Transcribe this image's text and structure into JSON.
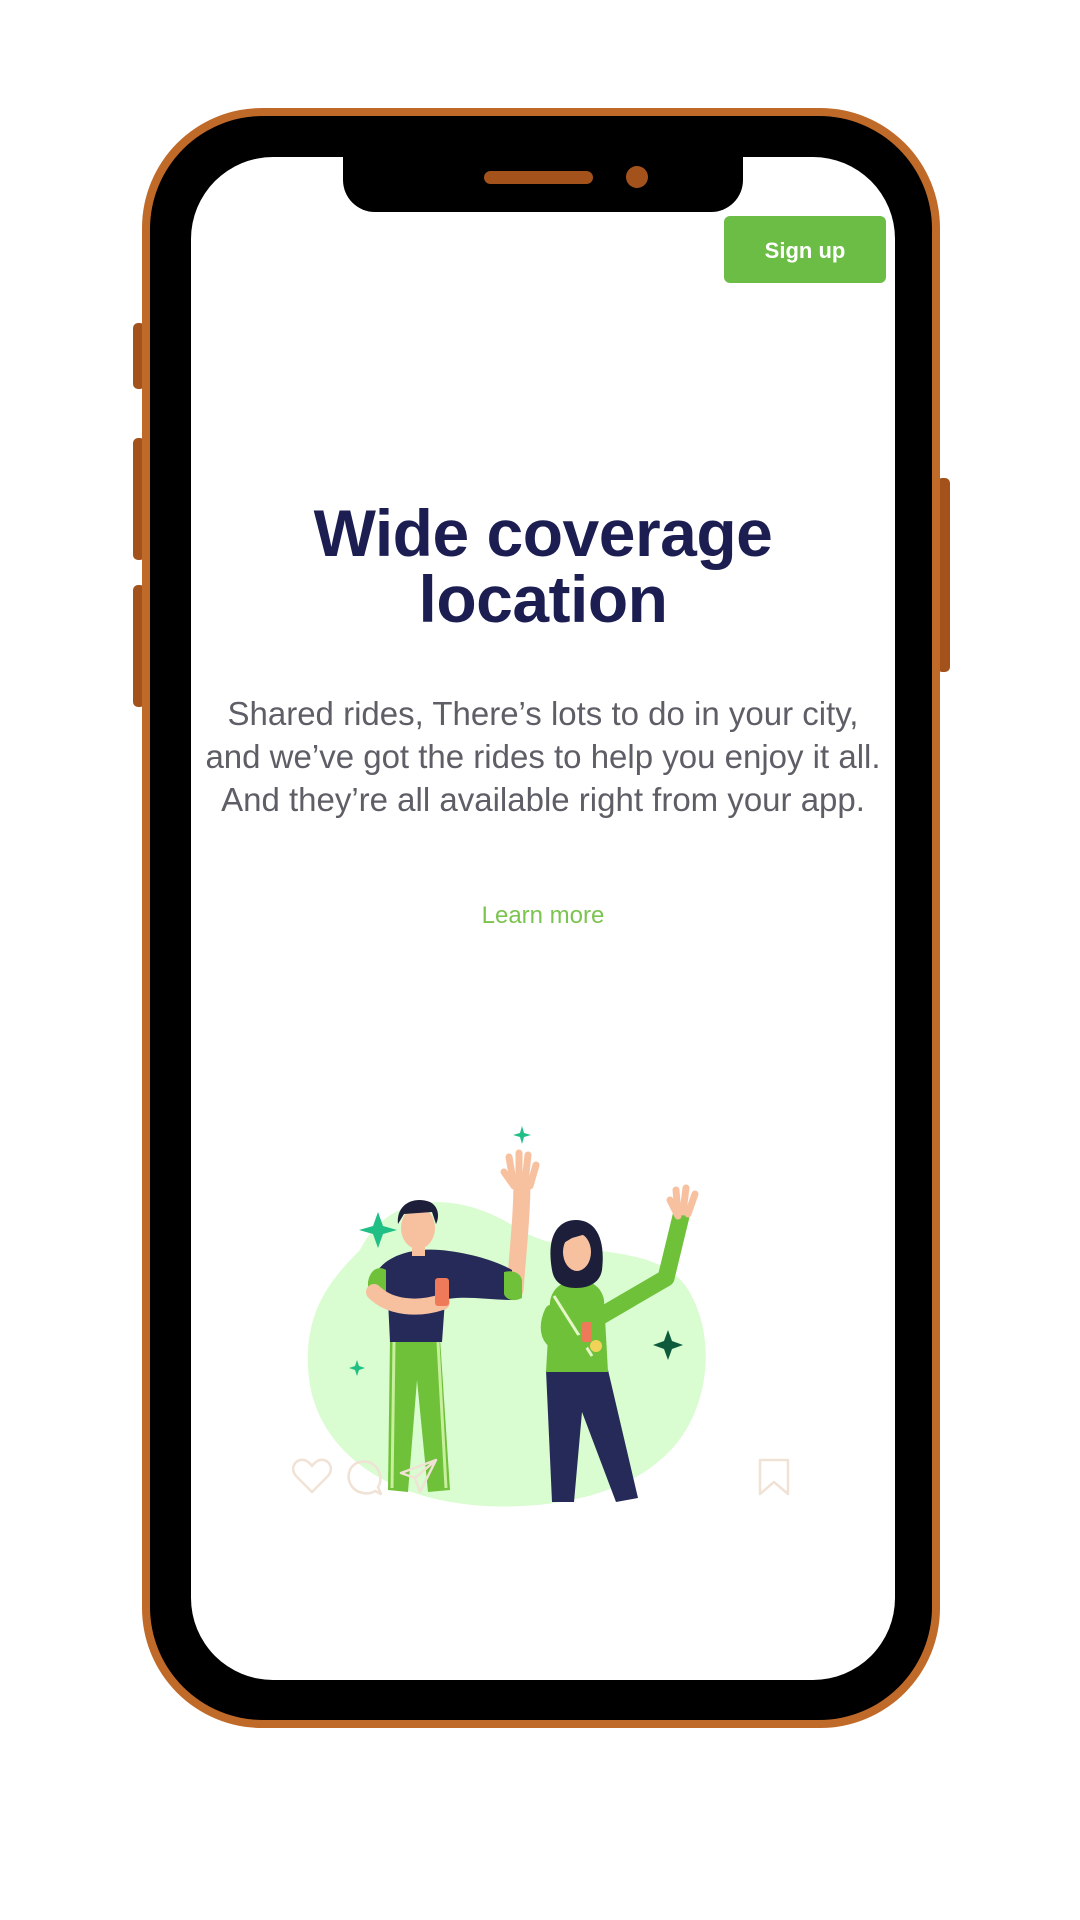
{
  "header": {
    "signup_label": "Sign up"
  },
  "hero": {
    "title_line1": "Wide coverage",
    "title_line2": "location",
    "description": "Shared rides, There’s lots to do in your city, and we’ve got the rides to help you enjoy it all. And they’re all available right from your app.",
    "learn_more_label": "Learn more"
  },
  "icons": {
    "illustration": "people-waving-illustration",
    "action_icons": [
      "heart-icon",
      "comment-icon",
      "send-icon",
      "bookmark-icon"
    ]
  },
  "colors": {
    "phone_frame": "#c06a2a",
    "accent_green": "#6cbd45",
    "title_navy": "#1c1e52",
    "body_gray": "#5e5f66",
    "blob_green": "#d9fcd0"
  }
}
